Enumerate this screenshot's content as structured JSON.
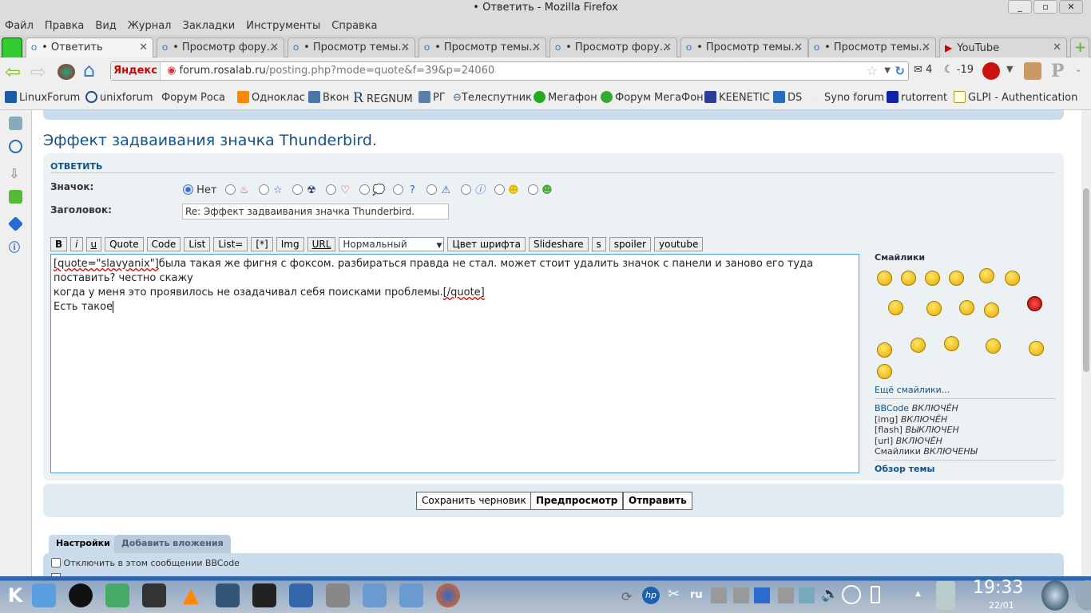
{
  "window": {
    "title": "• Ответить - Mozilla Firefox",
    "min": "_",
    "max": "▫",
    "close": "✕"
  },
  "menu": [
    "Файл",
    "Правка",
    "Вид",
    "Журнал",
    "Закладки",
    "Инструменты",
    "Справка"
  ],
  "tabs": [
    {
      "label": "• Ответить"
    },
    {
      "label": "• Просмотр фору..."
    },
    {
      "label": "• Просмотр темы..."
    },
    {
      "label": "• Просмотр темы..."
    },
    {
      "label": "• Просмотр фору..."
    },
    {
      "label": "• Просмотр темы..."
    },
    {
      "label": "• Просмотр темы..."
    },
    {
      "label": "YouTube"
    }
  ],
  "nav": {
    "search_engine": "Яндекс",
    "url_host": "forum.rosalab.ru",
    "url_path": "/posting.php?mode=quote&f=39&p=24060",
    "mail_count": "4",
    "weather": "-19"
  },
  "bookmarks": [
    "LinuxForum",
    "unixforum",
    "Форум Роса",
    "Одноклас",
    "Вкон",
    "REGNUM",
    "РГ",
    "Телеспутник",
    "Мегафон",
    "Форум МегаФон",
    "KEENETIC",
    "DS",
    "Syno forum",
    "rutorrent",
    "GLPI - Authentication"
  ],
  "page": {
    "title": "Эффект задваивания значка Thunderbird.",
    "section": "ОТВЕТИТЬ",
    "icon_label": "Значок:",
    "icon_none": "Нет",
    "subject_label": "Заголовок:",
    "subject_value": "Re: Эффект задваивания значка Thunderbird.",
    "toolbar": [
      "B",
      "i",
      "u",
      "Quote",
      "Code",
      "List",
      "List=",
      "[*]",
      "Img",
      "URL"
    ],
    "font_size": "Нормальный",
    "toolbar2": [
      "Цвет шрифта",
      "Slideshare",
      "s",
      "spoiler",
      "youtube"
    ],
    "editor": {
      "q_open": "[quote=\"slavyanix\"]",
      "line1": "была такая же фигня с фоксом. разбираться правда не стал. может стоит удалить значок с панели и заново его туда поставить? честно скажу",
      "line2": "когда у меня это проявилось не озадачивал себя поисками проблемы.",
      "q_close": "[/quote]",
      "line3": "Есть такое"
    },
    "smilies_title": "Смайлики",
    "more_smilies": "Ещё смайлики...",
    "status": [
      {
        "k": "BBCode",
        "v": "ВКЛЮЧЁН"
      },
      {
        "k": "[img]",
        "v": "ВКЛЮЧЁН"
      },
      {
        "k": "[flash]",
        "v": "ВЫКЛЮЧЕН"
      },
      {
        "k": "[url]",
        "v": "ВКЛЮЧЁН"
      },
      {
        "k": "Смайлики",
        "v": "ВКЛЮЧЕНЫ"
      }
    ],
    "topic_review": "Обзор темы",
    "save_draft": "Сохранить черновик",
    "preview": "Предпросмотр",
    "submit": "Отправить",
    "tab_settings": "Настройки",
    "tab_attach": "Добавить вложения",
    "opt1": "Отключить в этом сообщении BBCode"
  },
  "taskbar": {
    "lang": "ru",
    "time": "19:33",
    "date": "22/01"
  }
}
